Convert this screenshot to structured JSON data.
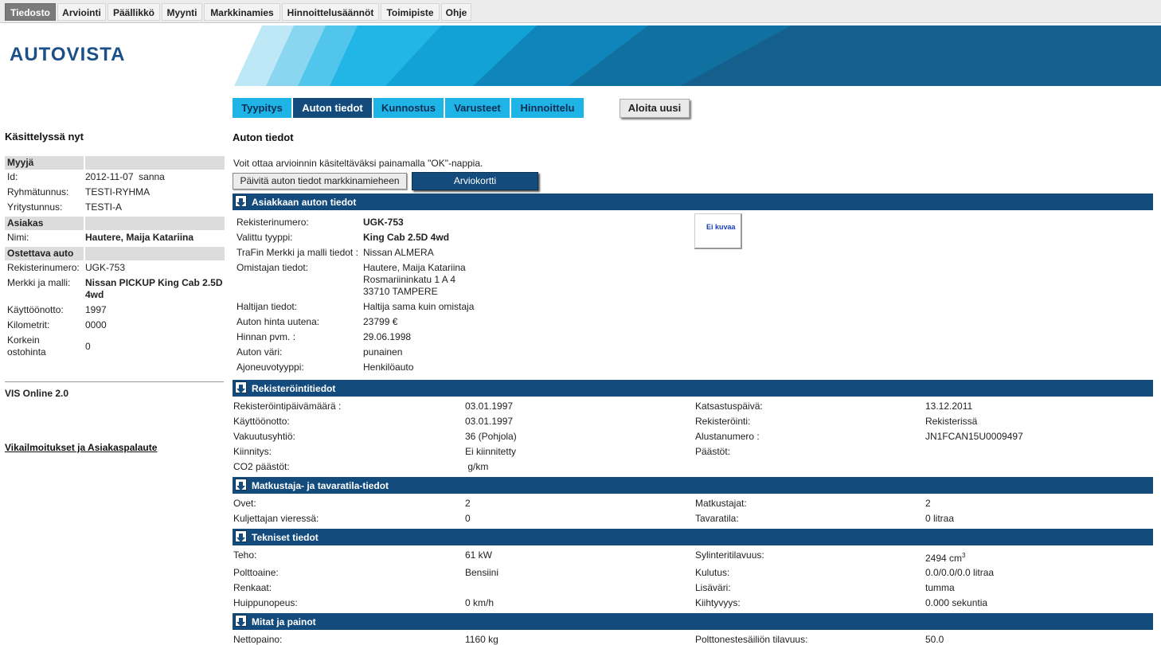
{
  "menu": [
    "Tiedosto",
    "Arviointi",
    "Päällikkö",
    "Myynti",
    "Markkinamies",
    "Hinnoittelusäännöt",
    "Toimipiste",
    "Ohje"
  ],
  "logo": "AUTOVISTA",
  "tabs": [
    "Tyypitys",
    "Auton tiedot",
    "Kunnostus",
    "Varusteet",
    "Hinnoittelu"
  ],
  "new_button": "Aloita uusi",
  "left": {
    "title": "Käsittelyssä nyt",
    "sec_seller": "Myyjä",
    "id_label": "Id:",
    "id_value": "2012-11-07  sanna",
    "group_label": "Ryhmätunnus:",
    "group_value": "TESTI-RYHMA",
    "company_label": "Yritystunnus:",
    "company_value": "TESTI-A",
    "sec_customer": "Asiakas",
    "name_label": "Nimi:",
    "name_value": "Hautere, Maija Katariina",
    "sec_car": "Ostettava auto",
    "reg_label": "Rekisterinumero:",
    "reg_value": "UGK-753",
    "make_label": "Merkki ja malli:",
    "make_value": "Nissan PICKUP King Cab 2.5D 4wd",
    "use_label": "Käyttöönotto:",
    "use_value": "1997",
    "km_label": "Kilometrit:",
    "km_value": "0000",
    "max_label": "Korkein ostohinta",
    "max_value": "0",
    "vis": "VIS Online 2.0",
    "feedback": "Vikailmoitukset ja Asiakaspalaute"
  },
  "main": {
    "title": "Auton tiedot",
    "intro": "Voit ottaa arvioinnin käsiteltäväksi painamalla \"OK\"-nappia.",
    "btn_update": "Päivitä auton tiedot markkinamieheen",
    "btn_card": "Arviokortti",
    "no_image": "Ei kuvaa"
  },
  "sections": {
    "s1": "Asiakkaan auton tiedot",
    "s2": "Rekisteröintitiedot",
    "s3": "Matkustaja- ja tavaratila-tiedot",
    "s4": "Tekniset tiedot",
    "s5": "Mitat ja painot"
  },
  "customer_car": {
    "reg_l": "Rekisterinumero:",
    "reg_v": "UGK-753",
    "type_l": "Valittu tyyppi:",
    "type_v": "King Cab 2.5D 4wd",
    "trafi_l": "TraFin Merkki ja malli tiedot :",
    "trafi_v": "Nissan ALMERA",
    "owner_l": "Omistajan tiedot:",
    "owner_v1": "Hautere, Maija Katariina",
    "owner_v2": "Rosmariininkatu 1 A 4",
    "owner_v3": "33710 TAMPERE",
    "holder_l": "Haltijan tiedot:",
    "holder_v": "Haltija sama kuin omistaja",
    "price_l": "Auton hinta uutena:",
    "price_v": "23799 €",
    "pdate_l": "Hinnan pvm. :",
    "pdate_v": "29.06.1998",
    "color_l": "Auton väri:",
    "color_v": "punainen",
    "vtype_l": "Ajoneuvotyyppi:",
    "vtype_v": "Henkilöauto"
  },
  "registration": {
    "regdate_l": "Rekisteröintipäivämäärä :",
    "regdate_v": "03.01.1997",
    "use_l": "Käyttöönotto:",
    "use_v": "03.01.1997",
    "ins_l": "Vakuutusyhtiö:",
    "ins_v": "36 (Pohjola)",
    "lien_l": "Kiinnitys:",
    "lien_v": "Ei kiinnitetty",
    "co2_l": "CO2 päästöt:",
    "co2_v": " g/km",
    "insp_l": "Katsastuspäivä:",
    "insp_v": "13.12.2011",
    "reg_l": "Rekisteröinti:",
    "reg_v": "Rekisterissä",
    "chassis_l": "Alustanumero :",
    "chassis_v": "JN1FCAN15U0009497",
    "emis_l": "Päästöt:",
    "emis_v": ""
  },
  "passenger": {
    "doors_l": "Ovet:",
    "doors_v": "2",
    "beside_l": "Kuljettajan vieressä:",
    "beside_v": "0",
    "pass_l": "Matkustajat:",
    "pass_v": "2",
    "cargo_l": "Tavaratila:",
    "cargo_v": "0 litraa"
  },
  "technical": {
    "power_l": "Teho:",
    "power_v": "61 kW",
    "fuel_l": "Polttoaine:",
    "fuel_v": "Bensiini",
    "tires_l": "Renkaat:",
    "tires_v": "",
    "speed_l": "Huippunopeus:",
    "speed_v": "0 km/h",
    "disp_l": "Sylinteritilavuus:",
    "disp_v": "2494 cm",
    "disp_unit": "3",
    "cons_l": "Kulutus:",
    "cons_v": "0.0/0.0/0.0 litraa",
    "extra_l": "Lisäväri:",
    "extra_v": "tumma",
    "acc_l": "Kiihtyvyys:",
    "acc_v": "0.000 sekuntia"
  },
  "dims": {
    "net_l": "Nettopaino:",
    "net_v": "1160 kg",
    "tank_l": "Polttonestesäiliön tilavuus:",
    "tank_v": "50.0"
  },
  "colors": {
    "accent_dark": "#134b7c",
    "accent_light": "#1eb4e6"
  }
}
